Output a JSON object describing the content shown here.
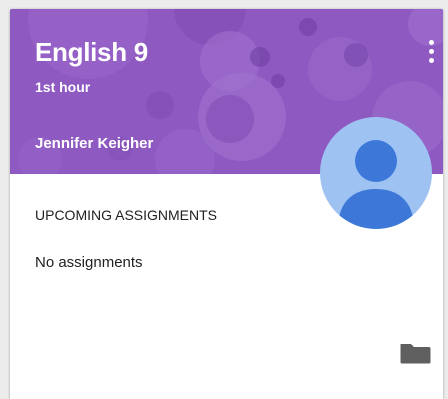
{
  "course_card": {
    "title": "English 9",
    "section": "1st hour",
    "teacher": "Jennifer Keigher",
    "upcoming_heading": "UPCOMING ASSIGNMENTS",
    "assignments_status": "No assignments"
  },
  "icons": {
    "menu": "more-vert-icon",
    "avatar": "person-icon",
    "folder": "folder-icon"
  },
  "colors": {
    "header": "#8e5ac1",
    "avatar_bg": "#9ec3f3",
    "avatar_fg": "#3d78d8",
    "text": "#212121"
  }
}
